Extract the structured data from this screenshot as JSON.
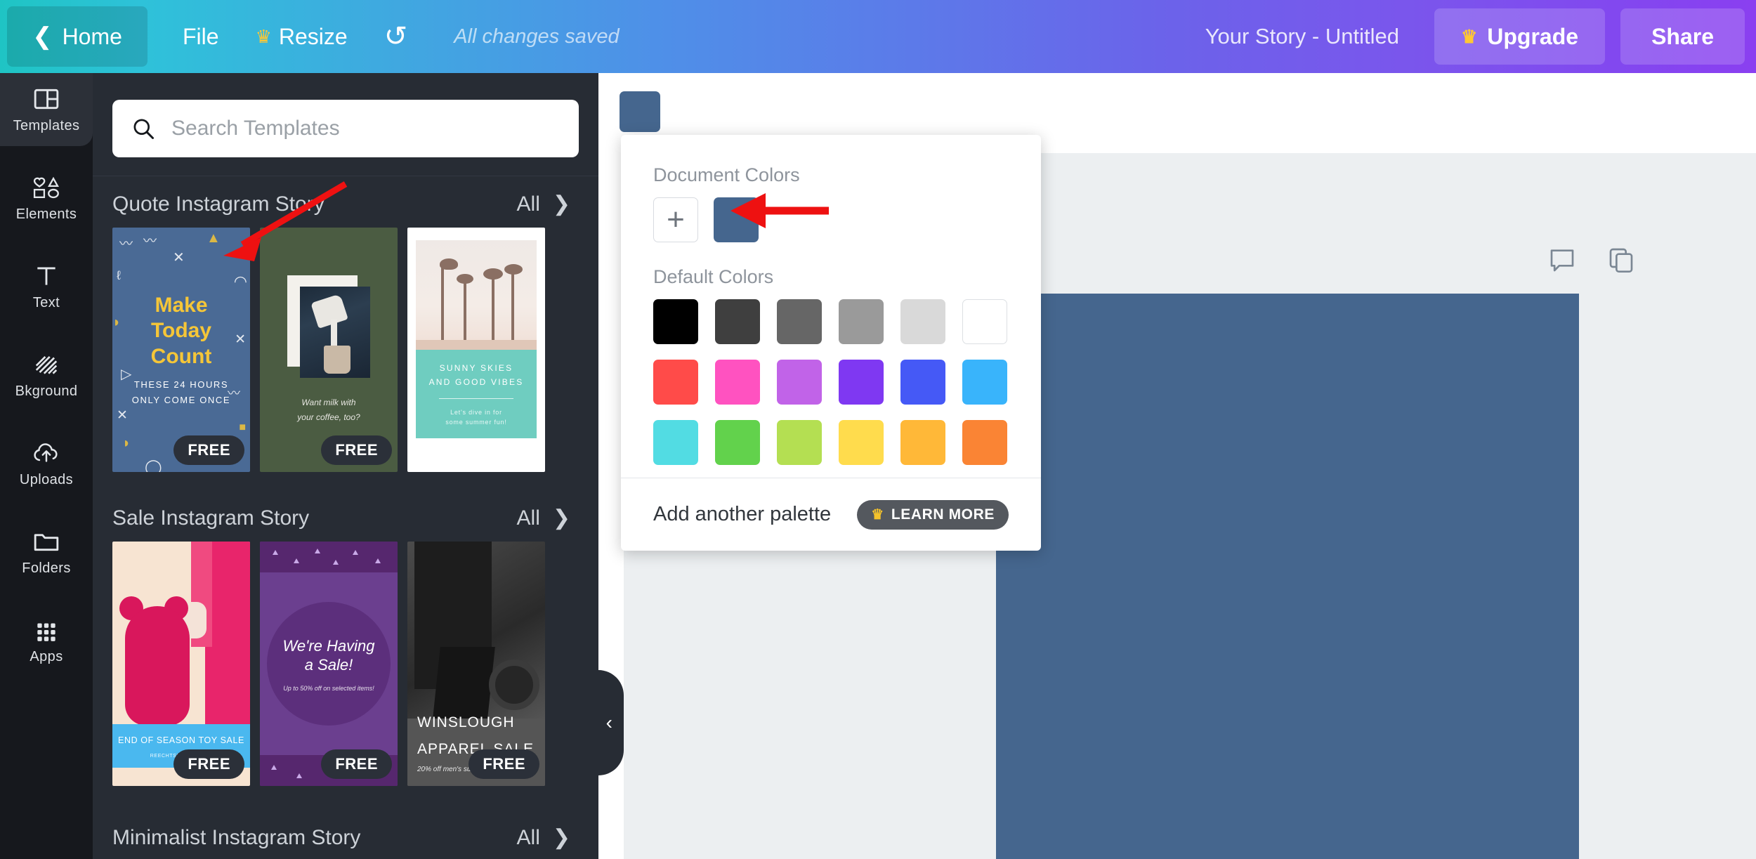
{
  "topbar": {
    "home_label": "Home",
    "file_label": "File",
    "resize_label": "Resize",
    "undo_glyph": "↺",
    "saved_text": "All changes saved",
    "doc_title": "Your Story - Untitled",
    "upgrade_label": "Upgrade",
    "share_label": "Share",
    "crown_glyph": "♛"
  },
  "rail": {
    "items": [
      {
        "label": "Templates",
        "icon": "templates-icon",
        "active": true
      },
      {
        "label": "Elements",
        "icon": "elements-icon",
        "active": false
      },
      {
        "label": "Text",
        "icon": "text-icon",
        "active": false
      },
      {
        "label": "Bkground",
        "icon": "background-icon",
        "active": false
      },
      {
        "label": "Uploads",
        "icon": "uploads-icon",
        "active": false
      },
      {
        "label": "Folders",
        "icon": "folders-icon",
        "active": false
      },
      {
        "label": "Apps",
        "icon": "apps-icon",
        "active": false
      }
    ]
  },
  "search": {
    "placeholder": "Search Templates",
    "icon": "search-icon"
  },
  "sections": [
    {
      "title": "Quote Instagram Story",
      "all_label": "All",
      "templates": [
        {
          "badge": "FREE",
          "kind": "quote",
          "headline": "Make\nToday\nCount",
          "line1": "Make",
          "line2": "Today",
          "line3": "Count",
          "sub1": "THESE 24 HOURS",
          "sub2": "ONLY COME ONCE"
        },
        {
          "badge": "FREE",
          "kind": "coffee",
          "cap1": "Want milk with",
          "cap2": "your coffee, too?"
        },
        {
          "badge": "",
          "kind": "sunny",
          "b1": "SUNNY SKIES",
          "b2": "AND GOOD VIBES",
          "b3": "Let's dive in for",
          "b4": "some summer fun!"
        }
      ]
    },
    {
      "title": "Sale Instagram Story",
      "all_label": "All",
      "templates": [
        {
          "badge": "FREE",
          "kind": "teddy",
          "strip": "END OF SEASON TOY SALE",
          "sub": "REECHTSPAN TOY CO."
        },
        {
          "badge": "FREE",
          "kind": "sale",
          "s1": "We're Having",
          "s2": "a Sale!",
          "s3": "Up to 50% off on selected items!"
        },
        {
          "badge": "FREE",
          "kind": "winslough",
          "w1": "WINSLOUGH",
          "w2": "APPAREL SALE",
          "w3": "20% off men's suits from"
        }
      ]
    },
    {
      "title": "Minimalist Instagram Story",
      "all_label": "All",
      "templates": []
    }
  ],
  "canvas": {
    "swatch_color": "#45668e",
    "artboard_color": "#45668e",
    "comment_icon": "comment-icon",
    "duplicate_icon": "duplicate-page-icon",
    "collapse_glyph": "‹"
  },
  "color_popover": {
    "document_colors_label": "Document Colors",
    "add_color_glyph": "+",
    "document_colors": [
      "#45668e"
    ],
    "default_colors_label": "Default Colors",
    "default_colors": [
      "#000000",
      "#3f3f3f",
      "#666666",
      "#9a9a9a",
      "#d9d9d9",
      "#ffffff",
      "#ff4b49",
      "#ff52c0",
      "#c163e8",
      "#7f38f2",
      "#4559f6",
      "#39b4fb",
      "#52dce3",
      "#62d24c",
      "#b4df52",
      "#ffdc4d",
      "#ffb838",
      "#fa8434"
    ],
    "add_palette_label": "Add another palette",
    "learn_more_label": "LEARN MORE",
    "learn_more_crown": "♛"
  },
  "annotations": {
    "arrow_color": "#ee1111",
    "arrows": [
      {
        "name": "arrow-to-template-thumbnail"
      },
      {
        "name": "arrow-to-document-color-swatch"
      }
    ]
  }
}
